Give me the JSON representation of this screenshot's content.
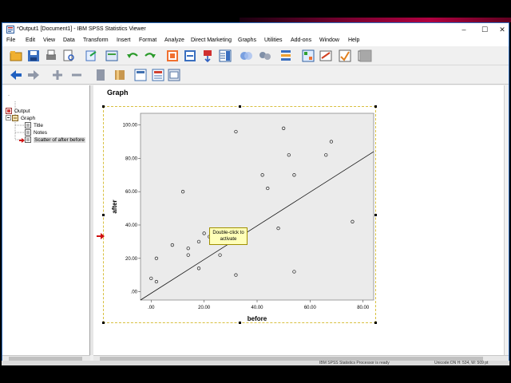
{
  "window": {
    "title": "*Output1 [Document1] - IBM SPSS Statistics Viewer",
    "minimize_glyph": "–",
    "maximize_glyph": "☐",
    "close_glyph": "✕"
  },
  "menu": [
    "File",
    "Edit",
    "View",
    "Data",
    "Transform",
    "Insert",
    "Format",
    "Analyze",
    "Direct Marketing",
    "Graphs",
    "Utilities",
    "Add-ons",
    "Window",
    "Help"
  ],
  "toolbar1_icons": [
    "open-icon",
    "save-icon",
    "print-icon",
    "print-preview-icon",
    "export-icon",
    "recall-dialog-icon",
    "undo-icon",
    "redo-icon",
    "goto-data-icon",
    "goto-case-icon",
    "goto-variable-icon",
    "variables-icon",
    "chart-icon",
    "create-titles-icon",
    "value-labels-icon",
    "use-variable-sets-icon",
    "show-all-variables-icon",
    "spell-check-icon",
    "designate-window-icon",
    "disabled-icon"
  ],
  "toolbar2_icons": [
    "back-arrow-icon",
    "forward-arrow-icon",
    "expand-plus-icon",
    "collapse-minus-icon",
    "show-icon",
    "hide-icon",
    "insert-heading-icon",
    "insert-title-icon",
    "insert-text-icon"
  ],
  "outline": {
    "items": [
      {
        "label": "Output",
        "level": 0
      },
      {
        "label": "Graph",
        "level": 1
      },
      {
        "label": "Title",
        "level": 2
      },
      {
        "label": "Notes",
        "level": 2
      },
      {
        "label": "Scatter of after before",
        "level": 2,
        "selected": true
      }
    ]
  },
  "content": {
    "heading": "Graph",
    "tooltip_line1": "Double-click to",
    "tooltip_line2": "activate"
  },
  "status": {
    "left": "IBM SPSS Statistics Processor is ready",
    "right": "Unicode:ON   H: 534, W: 509 pt"
  },
  "chart_data": {
    "type": "scatter",
    "xlabel": "before",
    "ylabel": "after",
    "xlim": [
      -4,
      84
    ],
    "ylim": [
      -5,
      107
    ],
    "xticks": [
      0,
      20,
      40,
      60,
      80
    ],
    "xtick_labels": [
      ".00",
      "20.00",
      "40.00",
      "60.00",
      "80.00"
    ],
    "yticks": [
      0,
      20,
      40,
      60,
      80,
      100
    ],
    "ytick_labels": [
      ".00",
      "20.00",
      "40.00",
      "60.00",
      "80.00",
      "100.00"
    ],
    "points": [
      {
        "x": 0,
        "y": 8
      },
      {
        "x": 2,
        "y": 6
      },
      {
        "x": 2,
        "y": 20
      },
      {
        "x": 8,
        "y": 28
      },
      {
        "x": 12,
        "y": 60
      },
      {
        "x": 14,
        "y": 26
      },
      {
        "x": 14,
        "y": 22
      },
      {
        "x": 18,
        "y": 30
      },
      {
        "x": 18,
        "y": 14
      },
      {
        "x": 20,
        "y": 35
      },
      {
        "x": 22,
        "y": 33
      },
      {
        "x": 26,
        "y": 22
      },
      {
        "x": 32,
        "y": 96
      },
      {
        "x": 32,
        "y": 10
      },
      {
        "x": 42,
        "y": 70
      },
      {
        "x": 44,
        "y": 62
      },
      {
        "x": 48,
        "y": 38
      },
      {
        "x": 50,
        "y": 98
      },
      {
        "x": 52,
        "y": 82
      },
      {
        "x": 54,
        "y": 70
      },
      {
        "x": 54,
        "y": 12
      },
      {
        "x": 66,
        "y": 82
      },
      {
        "x": 68,
        "y": 90
      },
      {
        "x": 76,
        "y": 42
      }
    ],
    "fit_line": {
      "x": [
        -4,
        84
      ],
      "y": [
        -5,
        84
      ]
    },
    "grid": false,
    "plot_background": "#ebebeb"
  }
}
